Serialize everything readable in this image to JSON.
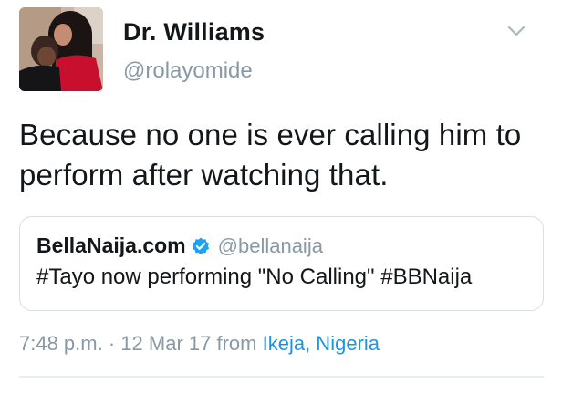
{
  "author": {
    "display_name": "Dr. Williams",
    "handle": "@rolayomide",
    "avatar_icon": "profile-photo"
  },
  "menu": {
    "icon": "chevron-down-icon"
  },
  "tweet": {
    "text": "Because no one is ever calling him to perform after watching that."
  },
  "quoted_tweet": {
    "display_name": "BellaNaija.com",
    "verified_icon": "verified-badge-icon",
    "handle": "@bellanaija",
    "text": "#Tayo now performing \"No Calling\" #BBNaija"
  },
  "meta": {
    "time": "7:48 p.m.",
    "separator": "·",
    "date": "12 Mar 17",
    "from_label": "from",
    "location": "Ikeja, Nigeria"
  },
  "colors": {
    "text_primary": "#14171a",
    "text_secondary": "#8899a6",
    "link": "#1b95e0",
    "verified": "#1da1f2",
    "border": "#d8dee3"
  }
}
